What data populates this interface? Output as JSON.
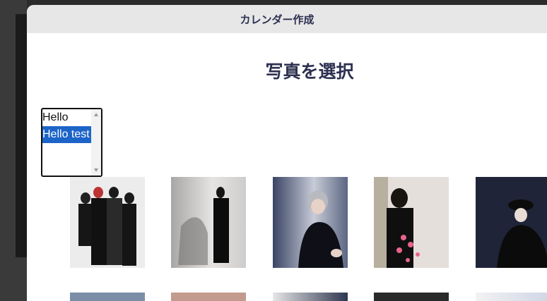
{
  "modal": {
    "header_title": "カレンダー作成",
    "heading": "写真を選択"
  },
  "listbox": {
    "options": [
      "Hello",
      "Hello test"
    ],
    "selected": "Hello test"
  },
  "photos": [
    {
      "name": "photo-1",
      "colors": {
        "bg": "#e9e9ea",
        "figure": "#151515"
      }
    },
    {
      "name": "photo-2",
      "colors": {
        "bg": "#cfcdcb",
        "figure": "#0c0c0c"
      }
    },
    {
      "name": "photo-3",
      "colors": {
        "bg": "#2c3552",
        "figure": "#0e0f17"
      }
    },
    {
      "name": "photo-4",
      "colors": {
        "bg": "#d8d1cd",
        "figure": "#111111"
      }
    },
    {
      "name": "photo-5",
      "colors": {
        "bg": "#1c2136",
        "figure": "#0b0b0b"
      }
    }
  ],
  "colors": {
    "accent": "#1d64c8",
    "title_text": "#2d3050",
    "header_bg": "#e7e7e7"
  }
}
